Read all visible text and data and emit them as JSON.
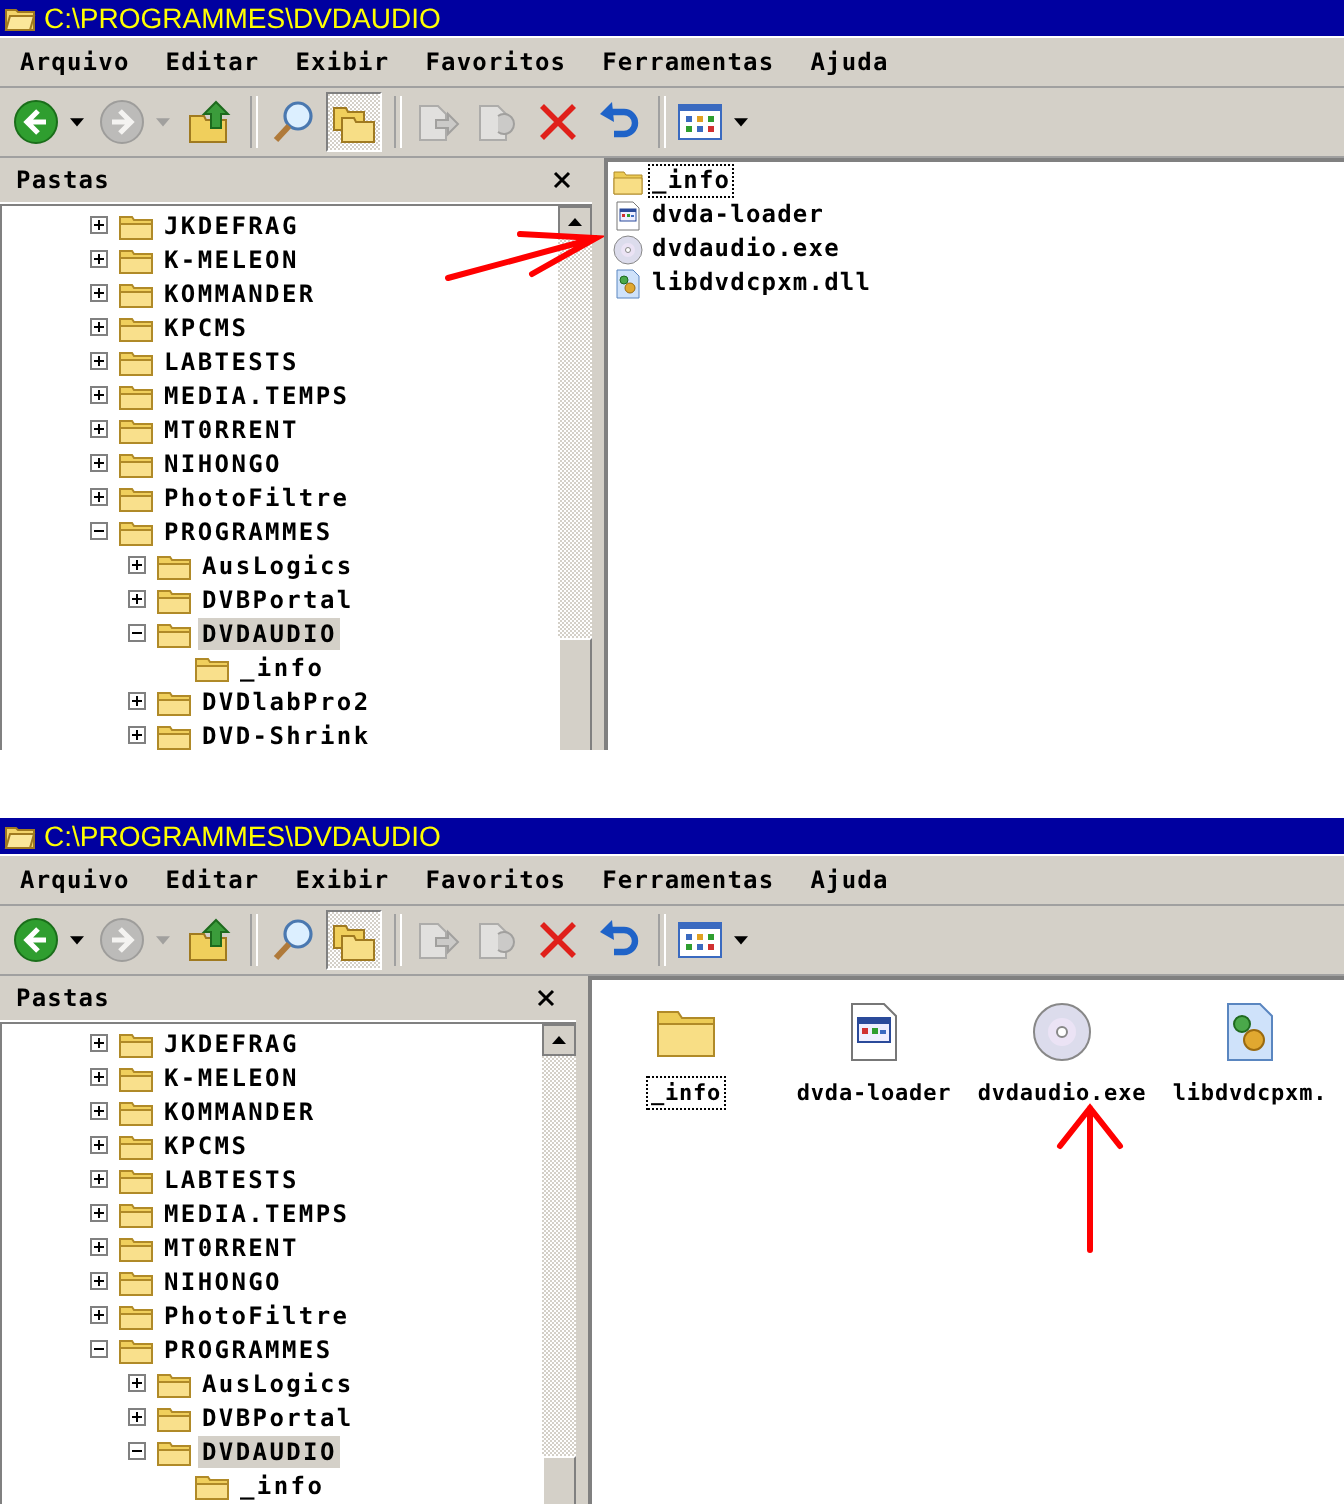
{
  "windows": [
    {
      "title": "C:\\PROGRAMMES\\DVDAUDIO",
      "menu": [
        "Arquivo",
        "Editar",
        "Exibir",
        "Favoritos",
        "Ferramentas",
        "Ajuda"
      ],
      "toolbar": [
        {
          "kind": "back",
          "dropdown": true,
          "disabled": false,
          "pressed": false
        },
        {
          "kind": "forward",
          "dropdown": true,
          "disabled": true,
          "pressed": false
        },
        {
          "kind": "up",
          "dropdown": false,
          "disabled": false,
          "pressed": false
        },
        {
          "kind": "separator"
        },
        {
          "kind": "search",
          "dropdown": false,
          "disabled": false,
          "pressed": false
        },
        {
          "kind": "folders",
          "dropdown": false,
          "disabled": false,
          "pressed": true
        },
        {
          "kind": "separator"
        },
        {
          "kind": "move",
          "dropdown": false,
          "disabled": true,
          "pressed": false
        },
        {
          "kind": "copy",
          "dropdown": false,
          "disabled": true,
          "pressed": false
        },
        {
          "kind": "delete",
          "dropdown": false,
          "disabled": false,
          "pressed": false
        },
        {
          "kind": "undo",
          "dropdown": false,
          "disabled": false,
          "pressed": false
        },
        {
          "kind": "separator"
        },
        {
          "kind": "views",
          "dropdown": true,
          "disabled": false,
          "pressed": false
        }
      ],
      "pane_title": "Pastas",
      "tree": [
        {
          "label": "JKDEFRAG",
          "expanded": false,
          "selected": false
        },
        {
          "label": "K-MELEON",
          "expanded": false,
          "selected": false
        },
        {
          "label": "KOMMANDER",
          "expanded": false,
          "selected": false
        },
        {
          "label": "KPCMS",
          "expanded": false,
          "selected": false
        },
        {
          "label": "LABTESTS",
          "expanded": false,
          "selected": false
        },
        {
          "label": "MEDIA.TEMPS",
          "expanded": false,
          "selected": false
        },
        {
          "label": "MT0RRENT",
          "expanded": false,
          "selected": false
        },
        {
          "label": "NIHONGO",
          "expanded": false,
          "selected": false
        },
        {
          "label": "PhotoFiltre",
          "expanded": false,
          "selected": false
        },
        {
          "label": "PROGRAMMES",
          "expanded": true,
          "selected": false,
          "children": [
            {
              "label": "AusLogics",
              "expanded": false,
              "selected": false
            },
            {
              "label": "DVBPortal",
              "expanded": false,
              "selected": false
            },
            {
              "label": "DVDAUDIO",
              "expanded": true,
              "selected": true,
              "children": [
                {
                  "label": "_info",
                  "selected": false
                }
              ]
            },
            {
              "label": "DVDlabPro2",
              "expanded": false,
              "selected": false
            },
            {
              "label": "DVD-Shrink",
              "expanded": false,
              "selected": false
            }
          ]
        }
      ],
      "kind": "list",
      "files": [
        {
          "name": "_info",
          "kind": "folder",
          "selected": true
        },
        {
          "name": "dvda-loader",
          "kind": "app",
          "selected": false
        },
        {
          "name": "dvdaudio.exe",
          "kind": "disc",
          "selected": false
        },
        {
          "name": "libdvdcpxm.dll",
          "kind": "library",
          "selected": false
        }
      ],
      "annotations": [
        {
          "kind": "right-arrow"
        }
      ]
    },
    {
      "title": "C:\\PROGRAMMES\\DVDAUDIO",
      "menu": [
        "Arquivo",
        "Editar",
        "Exibir",
        "Favoritos",
        "Ferramentas",
        "Ajuda"
      ],
      "toolbar": [
        {
          "kind": "back",
          "dropdown": true,
          "disabled": false,
          "pressed": false
        },
        {
          "kind": "forward",
          "dropdown": true,
          "disabled": true,
          "pressed": false
        },
        {
          "kind": "up",
          "dropdown": false,
          "disabled": false,
          "pressed": false
        },
        {
          "kind": "separator"
        },
        {
          "kind": "search",
          "dropdown": false,
          "disabled": false,
          "pressed": false
        },
        {
          "kind": "folders",
          "dropdown": false,
          "disabled": false,
          "pressed": true
        },
        {
          "kind": "separator"
        },
        {
          "kind": "move",
          "dropdown": false,
          "disabled": true,
          "pressed": false
        },
        {
          "kind": "copy",
          "dropdown": false,
          "disabled": true,
          "pressed": false
        },
        {
          "kind": "delete",
          "dropdown": false,
          "disabled": false,
          "pressed": false
        },
        {
          "kind": "undo",
          "dropdown": false,
          "disabled": false,
          "pressed": false
        },
        {
          "kind": "separator"
        },
        {
          "kind": "views",
          "dropdown": true,
          "disabled": false,
          "pressed": false
        }
      ],
      "pane_title": "Pastas",
      "tree": [
        {
          "label": "JKDEFRAG",
          "expanded": false,
          "selected": false
        },
        {
          "label": "K-MELEON",
          "expanded": false,
          "selected": false
        },
        {
          "label": "KOMMANDER",
          "expanded": false,
          "selected": false
        },
        {
          "label": "KPCMS",
          "expanded": false,
          "selected": false
        },
        {
          "label": "LABTESTS",
          "expanded": false,
          "selected": false
        },
        {
          "label": "MEDIA.TEMPS",
          "expanded": false,
          "selected": false
        },
        {
          "label": "MT0RRENT",
          "expanded": false,
          "selected": false
        },
        {
          "label": "NIHONGO",
          "expanded": false,
          "selected": false
        },
        {
          "label": "PhotoFiltre",
          "expanded": false,
          "selected": false
        },
        {
          "label": "PROGRAMMES",
          "expanded": true,
          "selected": false,
          "children": [
            {
              "label": "AusLogics",
              "expanded": false,
              "selected": false
            },
            {
              "label": "DVBPortal",
              "expanded": false,
              "selected": false
            },
            {
              "label": "DVDAUDIO",
              "expanded": true,
              "selected": true,
              "children": [
                {
                  "label": "_info",
                  "selected": false
                }
              ]
            }
          ]
        }
      ],
      "kind": "icons",
      "files": [
        {
          "name": "_info",
          "kind": "folder",
          "selected": true
        },
        {
          "name": "dvda-loader",
          "kind": "app",
          "selected": false
        },
        {
          "name": "dvdaudio.exe",
          "kind": "disc",
          "selected": false
        },
        {
          "name": "libdvdcpxm.",
          "kind": "library",
          "selected": false
        }
      ],
      "annotations": [
        {
          "kind": "up-arrow"
        }
      ]
    }
  ]
}
